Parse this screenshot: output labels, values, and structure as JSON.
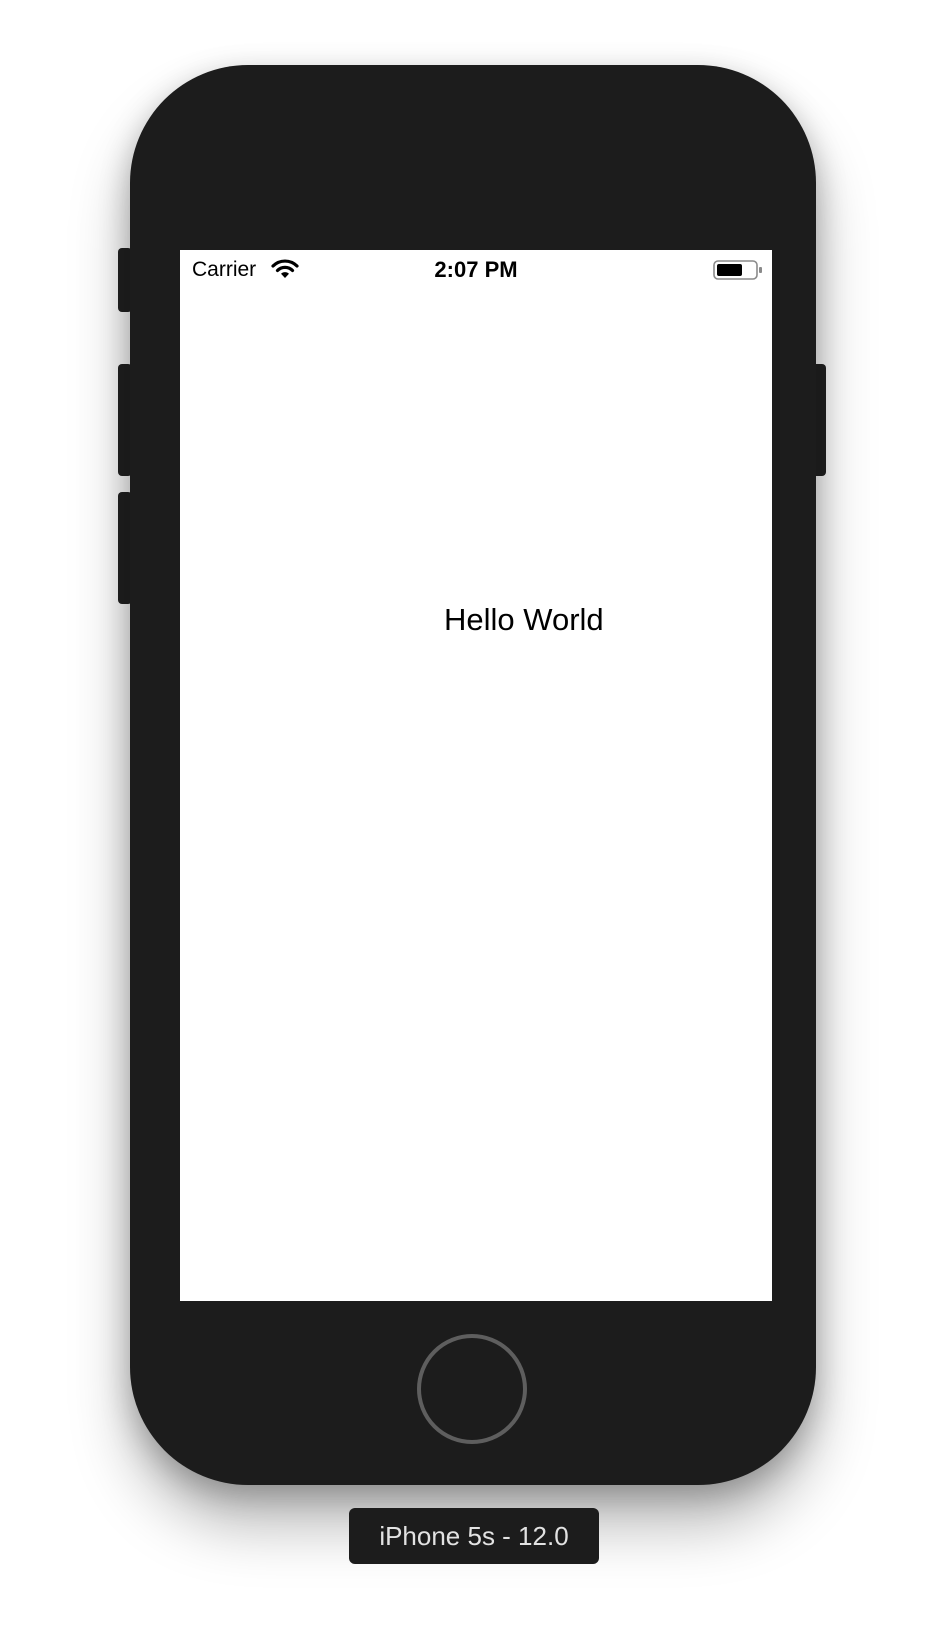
{
  "status_bar": {
    "carrier": "Carrier",
    "time": "2:07 PM",
    "wifi_icon": "wifi-icon",
    "battery_icon": "battery-icon"
  },
  "content": {
    "label": "Hello World"
  },
  "device": {
    "name": "iPhone 5s - 12.0",
    "body_color": "#1c1c1c",
    "screen_color": "#ffffff"
  }
}
